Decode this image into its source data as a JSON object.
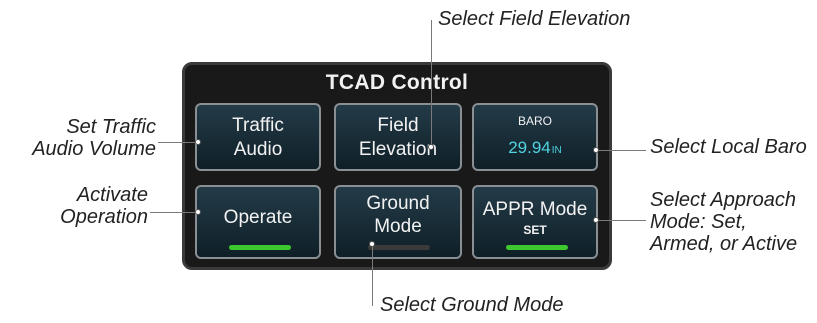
{
  "panel": {
    "title": "TCAD Control",
    "buttons": {
      "traffic_audio": {
        "line1": "Traffic",
        "line2": "Audio"
      },
      "field_elevation": {
        "line1": "Field",
        "line2": "Elevation"
      },
      "baro": {
        "label": "BARO",
        "value": "29.94",
        "unit": "IN"
      },
      "operate": {
        "label": "Operate",
        "indicator": "on"
      },
      "ground_mode": {
        "line1": "Ground",
        "line2": "Mode",
        "indicator": "off"
      },
      "appr_mode": {
        "label": "APPR Mode",
        "status": "SET",
        "indicator": "on"
      }
    }
  },
  "callouts": {
    "field_elevation": "Select Field Elevation",
    "traffic_audio": {
      "line1": "Set Traffic",
      "line2": "Audio Volume"
    },
    "baro": "Select Local Baro",
    "operate": {
      "line1": "Activate",
      "line2": "Operation"
    },
    "appr_mode": {
      "line1": "Select Approach",
      "line2": "Mode: Set,",
      "line3": "Armed, or Active"
    },
    "ground_mode": "Select Ground Mode"
  },
  "colors": {
    "indicator_on": "#3ec82f",
    "indicator_off": "#3a3a3a",
    "value_cyan": "#4fd3e0",
    "panel_bg": "#191919"
  }
}
